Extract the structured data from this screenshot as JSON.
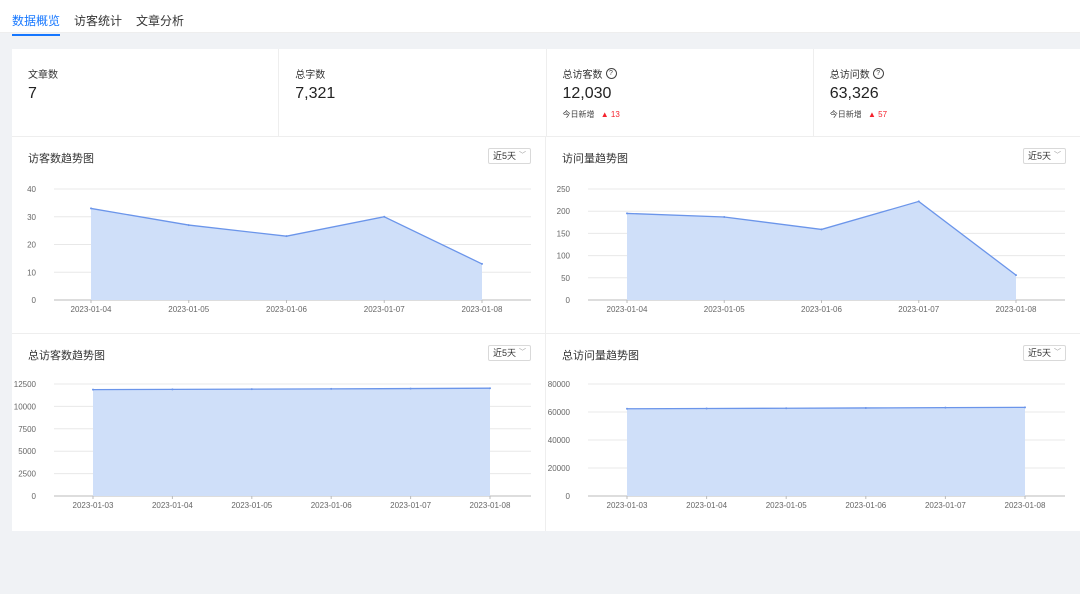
{
  "tabs": [
    {
      "label": "数据概览",
      "active": true
    },
    {
      "label": "访客统计",
      "active": false
    },
    {
      "label": "文章分析",
      "active": false
    }
  ],
  "stats": [
    {
      "label": "文章数",
      "value": "7",
      "help": false
    },
    {
      "label": "总字数",
      "value": "7,321",
      "help": false
    },
    {
      "label": "总访客数",
      "value": "12,030",
      "help": true,
      "today_label": "今日新增",
      "today_value": "13"
    },
    {
      "label": "总访问数",
      "value": "63,326",
      "help": true,
      "today_label": "今日新增",
      "today_value": "57"
    }
  ],
  "colors": {
    "accent": "#1677ff",
    "line": "#6b95ea",
    "fill": "#cfdff9",
    "up": "#f5222d"
  },
  "chart_data": [
    {
      "type": "area",
      "title": "访客数趋势图",
      "range_label": "近5天",
      "x": [
        "2023-01-04",
        "2023-01-05",
        "2023-01-06",
        "2023-01-07",
        "2023-01-08"
      ],
      "values": [
        33,
        27,
        23,
        30,
        13
      ],
      "ylim": [
        0,
        40
      ],
      "yticks": [
        "0",
        "10",
        "20",
        "30",
        "40"
      ],
      "grid": true
    },
    {
      "type": "area",
      "title": "访问量趋势图",
      "range_label": "近5天",
      "x": [
        "2023-01-04",
        "2023-01-05",
        "2023-01-06",
        "2023-01-07",
        "2023-01-08"
      ],
      "values": [
        195,
        187,
        159,
        222,
        56
      ],
      "ylim": [
        0,
        250
      ],
      "yticks": [
        "0",
        "50",
        "100",
        "150",
        "200",
        "250"
      ],
      "grid": true
    },
    {
      "type": "area",
      "title": "总访客数趋势图",
      "range_label": "近5天",
      "x": [
        "2023-01-03",
        "2023-01-04",
        "2023-01-05",
        "2023-01-06",
        "2023-01-07",
        "2023-01-08"
      ],
      "values": [
        11870,
        11903,
        11930,
        11960,
        11990,
        12030
      ],
      "ylim": [
        0,
        12500
      ],
      "yticks": [
        "0",
        "2500",
        "5000",
        "7500",
        "10000",
        "12500"
      ],
      "grid": true
    },
    {
      "type": "area",
      "title": "总访问量趋势图",
      "range_label": "近5天",
      "x": [
        "2023-01-03",
        "2023-01-04",
        "2023-01-05",
        "2023-01-06",
        "2023-01-07",
        "2023-01-08"
      ],
      "values": [
        62300,
        62500,
        62700,
        62900,
        63100,
        63326
      ],
      "ylim": [
        0,
        80000
      ],
      "yticks": [
        "0",
        "20000",
        "40000",
        "60000",
        "80000"
      ],
      "grid": true
    }
  ]
}
